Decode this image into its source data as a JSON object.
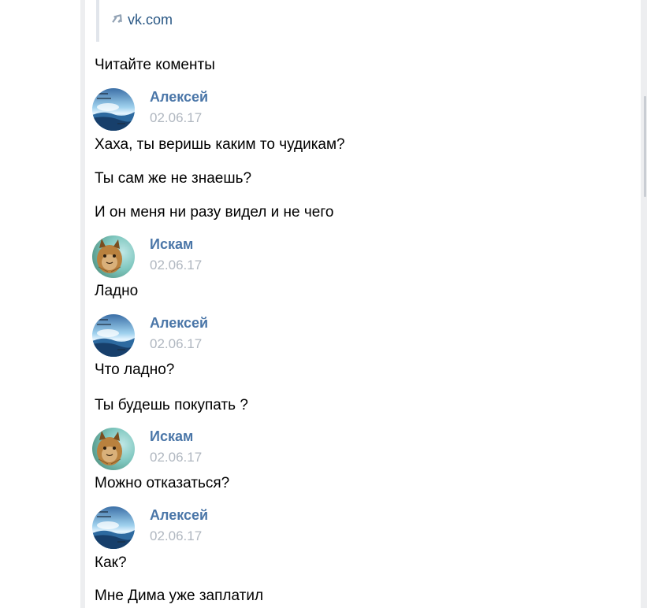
{
  "attachment": {
    "link_text": "vk.com"
  },
  "intro_text": "Читайте коменты",
  "posts": [
    {
      "author": "Алексей",
      "date": "02.06.17",
      "lines": [
        "Хаха, ты веришь каким то чудикам?",
        "Ты сам же не знаешь?",
        "И он меня ни разу видел и не чего"
      ]
    },
    {
      "author": "Искам",
      "date": "02.06.17",
      "lines": [
        "Ладно"
      ]
    },
    {
      "author": "Алексей",
      "date": "02.06.17",
      "lines": [
        "Что ладно?",
        "Ты будешь покупать ?"
      ]
    },
    {
      "author": "Искам",
      "date": "02.06.17",
      "lines": [
        "Можно отказаться?"
      ]
    },
    {
      "author": "Алексей",
      "date": "02.06.17",
      "lines": [
        "Как?",
        "Мне Дима уже заплатил"
      ]
    }
  ],
  "colors": {
    "author_name": "#4a76a8",
    "date": "#b0b7c0",
    "link": "#2a5885",
    "rail": "#edeef0"
  },
  "icons": {
    "link": "external-link-icon",
    "avatar_aleksey": "sky-sea-avatar",
    "avatar_iskam": "lynx-avatar"
  }
}
